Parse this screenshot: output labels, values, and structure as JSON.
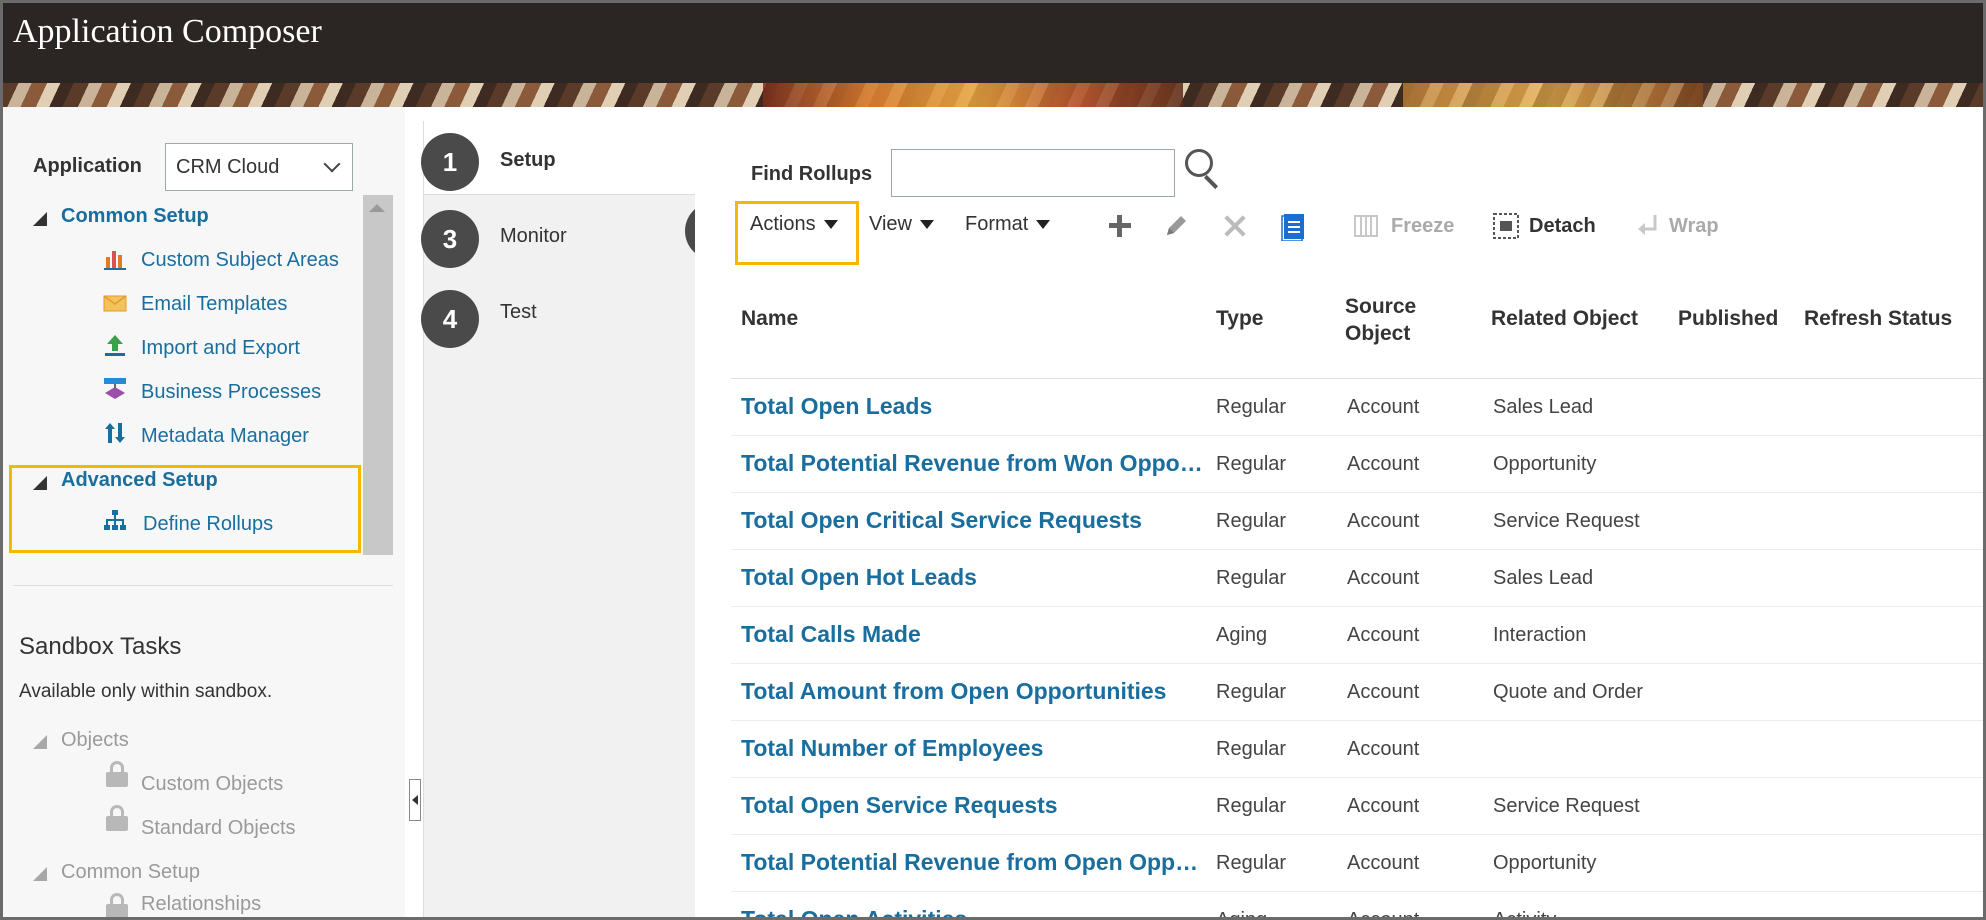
{
  "header": {
    "title": "Application Composer"
  },
  "left_panel": {
    "application_label": "Application",
    "application_value": "CRM Cloud",
    "common_setup": {
      "title": "Common Setup",
      "items": [
        {
          "label": "Custom Subject Areas",
          "icon": "bar-chart-icon"
        },
        {
          "label": "Email Templates",
          "icon": "envelope-icon"
        },
        {
          "label": "Import and Export",
          "icon": "upload-icon"
        },
        {
          "label": "Business Processes",
          "icon": "process-icon"
        },
        {
          "label": "Metadata Manager",
          "icon": "sort-arrows-icon"
        }
      ]
    },
    "advanced_setup": {
      "title": "Advanced Setup",
      "items": [
        {
          "label": "Define Rollups",
          "icon": "hierarchy-icon"
        }
      ]
    },
    "sandbox": {
      "title": "Sandbox Tasks",
      "subtitle": "Available only within sandbox.",
      "objects_title": "Objects",
      "objects_items": [
        "Custom Objects",
        "Standard Objects"
      ],
      "common_title": "Common Setup",
      "common_items": [
        "Relationships"
      ]
    }
  },
  "steps": [
    {
      "num": "1",
      "label": "Setup"
    },
    {
      "num": "3",
      "label": "Monitor"
    },
    {
      "num": "4",
      "label": "Test"
    }
  ],
  "callout_actions": "2",
  "search": {
    "label": "Find Rollups",
    "value": "",
    "placeholder": ""
  },
  "toolbar": {
    "actions": "Actions",
    "view": "View",
    "format": "Format",
    "freeze": "Freeze",
    "detach": "Detach",
    "wrap": "Wrap"
  },
  "table": {
    "columns": [
      "Name",
      "Type",
      "Source Object",
      "Related Object",
      "Published",
      "Refresh Status"
    ],
    "rows": [
      {
        "name": "Total Open Leads",
        "type": "Regular",
        "source": "Account",
        "related": "Sales Lead"
      },
      {
        "name": "Total Potential Revenue from Won Opportunities",
        "type": "Regular",
        "source": "Account",
        "related": "Opportunity"
      },
      {
        "name": "Total Open Critical Service Requests",
        "type": "Regular",
        "source": "Account",
        "related": "Service Request"
      },
      {
        "name": "Total Open Hot Leads",
        "type": "Regular",
        "source": "Account",
        "related": "Sales Lead"
      },
      {
        "name": "Total Calls Made",
        "type": "Aging",
        "source": "Account",
        "related": "Interaction"
      },
      {
        "name": "Total Amount from Open Opportunities",
        "type": "Regular",
        "source": "Account",
        "related": "Quote and Order"
      },
      {
        "name": "Total Number of Employees",
        "type": "Regular",
        "source": "Account",
        "related": ""
      },
      {
        "name": "Total Open Service Requests",
        "type": "Regular",
        "source": "Account",
        "related": "Service Request"
      },
      {
        "name": "Total Potential Revenue from Open Opportunities",
        "type": "Regular",
        "source": "Account",
        "related": "Opportunity"
      },
      {
        "name": "Total Open Activities",
        "type": "Aging",
        "source": "Account",
        "related": "Activity"
      }
    ]
  },
  "colors": {
    "accent": "#1a6e9e",
    "highlight": "#f5b800",
    "header_bg": "#2b2624"
  }
}
